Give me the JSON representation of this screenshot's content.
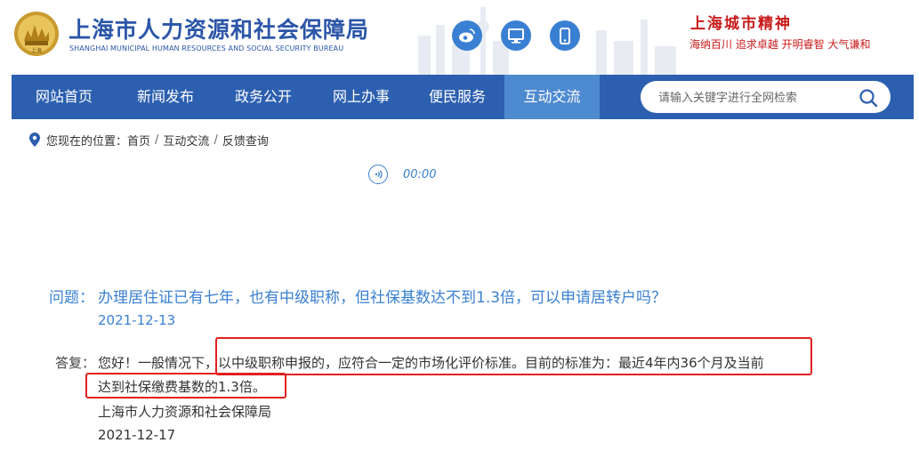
{
  "header": {
    "title": "上海市人力资源和社会保障局",
    "subtitle": "SHANGHAI MUNICIPAL HUMAN RESOURCES AND SOCIAL SECURITY BUREAU",
    "emblem_text": "上海",
    "social_icons": [
      "weibo-icon",
      "desktop-icon",
      "mobile-icon"
    ],
    "slogan_title": "上海城市精神",
    "slogan": "海纳百川  追求卓越  开明睿智  大气谦和"
  },
  "nav": {
    "items": [
      {
        "label": "网站首页"
      },
      {
        "label": "新闻发布"
      },
      {
        "label": "政务公开"
      },
      {
        "label": "网上办事"
      },
      {
        "label": "便民服务"
      },
      {
        "label": "互动交流",
        "active": true
      }
    ]
  },
  "search": {
    "placeholder": "请输入关键字进行全网检索",
    "icon": "search-icon"
  },
  "breadcrumb": {
    "prefix": "您现在的位置：",
    "items": [
      "首页",
      "互动交流",
      "反馈查询"
    ],
    "separator": "/"
  },
  "audio": {
    "time": "00:00"
  },
  "question": {
    "label": "问题：",
    "text": "办理居住证已有七年，也有中级职称，但社保基数达不到1.3倍，可以申请居转户吗？",
    "date": "2021-12-13"
  },
  "answer": {
    "label": "答复：",
    "line1": "您好！一般情况下，以中级职称申报的，应符合一定的市场化评价标准。目前的标准为：最近4年内36个月及当前",
    "line2": "达到社保缴费基数的1.3倍。",
    "signature": "上海市人力资源和社会保障局",
    "date": "2021-12-17"
  },
  "colors": {
    "nav_bg": "#2c5faf",
    "nav_active": "#4e8ad0",
    "link_blue": "#3a80d2",
    "slogan_red": "#c81a1a",
    "highlight_red": "#e02020"
  }
}
